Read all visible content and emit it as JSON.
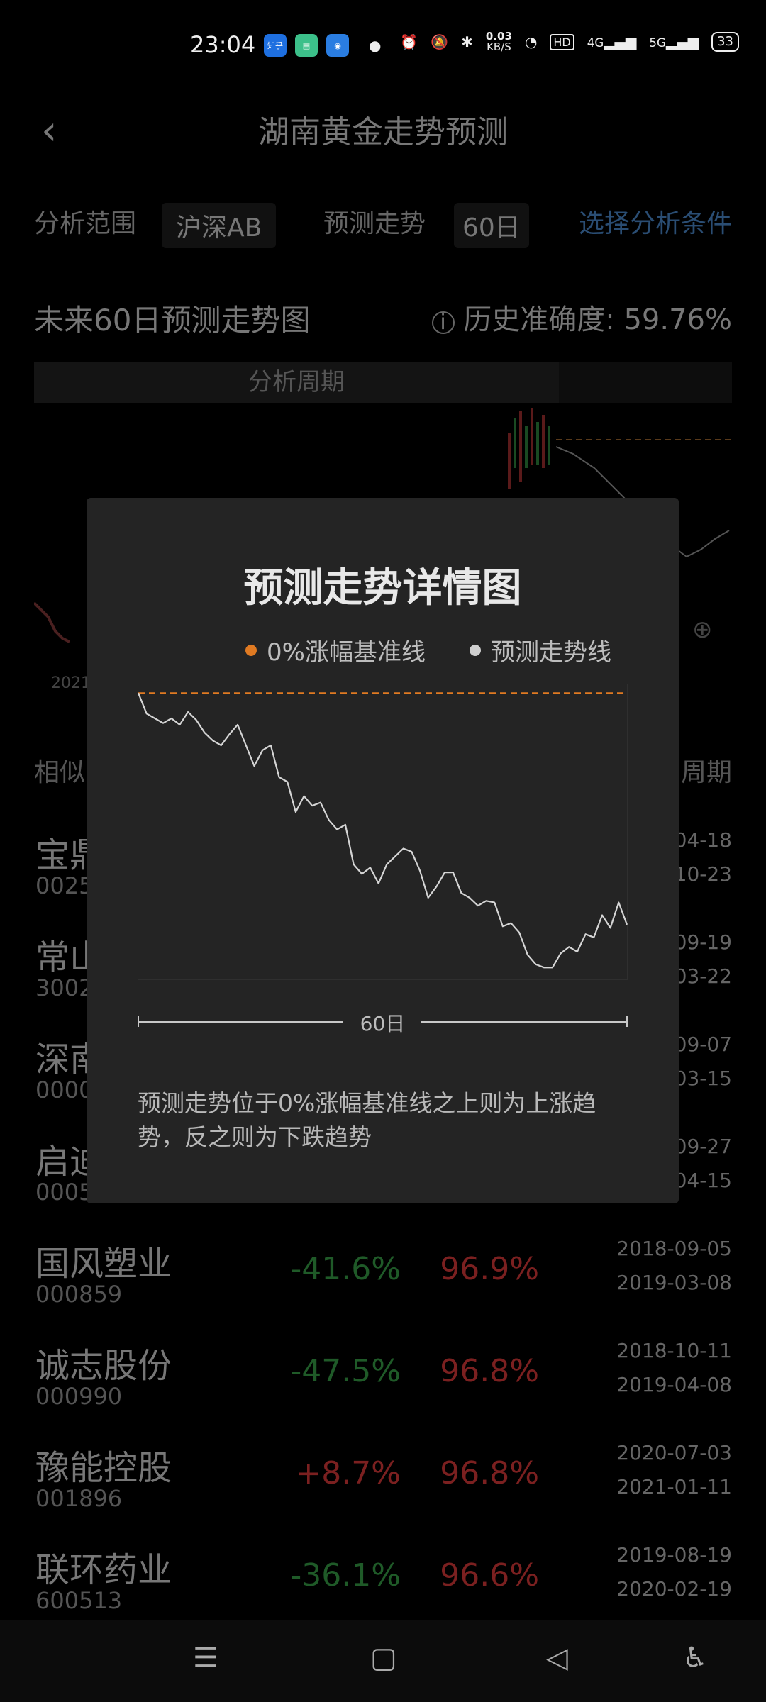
{
  "status_bar": {
    "time": "23:04",
    "app_icon_zhihu": "知乎",
    "net_speed_value": "0.03",
    "net_speed_unit": "KB/S",
    "hd_label": "HD",
    "net1": "4G",
    "net2": "5G",
    "battery": "33"
  },
  "header": {
    "title": "湖南黄金走势预测"
  },
  "filters": {
    "range_label": "分析范围",
    "range_value": "沪深AB",
    "trend_label": "预测走势",
    "trend_value": "60日",
    "choose_link": "选择分析条件"
  },
  "main_chart": {
    "title": "未来60日预测走势图",
    "accuracy_label": "历史准确度:",
    "accuracy_value": "59.76%",
    "period_label": "分析周期",
    "partial_year": "2021"
  },
  "list": {
    "header_left": "相似",
    "header_right": "周期",
    "rows": [
      {
        "name": "宝鼎",
        "code": "0025",
        "change": "",
        "prob": "",
        "date1": "04-18",
        "date2": "10-23"
      },
      {
        "name": "常山",
        "code": "3002",
        "change": "",
        "prob": "",
        "date1": "09-19",
        "date2": "03-22"
      },
      {
        "name": "深南",
        "code": "0000",
        "change": "",
        "prob": "",
        "date1": "09-07",
        "date2": "03-15"
      },
      {
        "name": "启迪",
        "code": "0005",
        "change": "",
        "prob": "",
        "date1": "09-27",
        "date2": "04-15"
      },
      {
        "name": "国风塑业",
        "code": "000859",
        "change": "-41.6%",
        "prob": "96.9%",
        "date1": "2018-09-05",
        "date2": "2019-03-08"
      },
      {
        "name": "诚志股份",
        "code": "000990",
        "change": "-47.5%",
        "prob": "96.8%",
        "date1": "2018-10-11",
        "date2": "2019-04-08"
      },
      {
        "name": "豫能控股",
        "code": "001896",
        "change": "+8.7%",
        "prob": "96.8%",
        "date1": "2020-07-03",
        "date2": "2021-01-11"
      },
      {
        "name": "联环药业",
        "code": "600513",
        "change": "-36.1%",
        "prob": "96.6%",
        "date1": "2019-08-19",
        "date2": "2020-02-19"
      }
    ]
  },
  "modal": {
    "title": "预测走势详情图",
    "legend_baseline": "0%涨幅基准线",
    "legend_forecast": "预测走势线",
    "period_label": "60日",
    "description": "预测走势位于0%涨幅基准线之上则为上涨趋势，反之则为下跌趋势",
    "colors": {
      "baseline": "#e07a22",
      "forecast": "#cfcfcf",
      "background": "#242424"
    }
  },
  "chart_data": {
    "type": "line",
    "title": "",
    "x": [
      1,
      2,
      3,
      4,
      5,
      6,
      7,
      8,
      9,
      10,
      11,
      12,
      13,
      14,
      15,
      16,
      17,
      18,
      19,
      20,
      21,
      22,
      23,
      24,
      25,
      26,
      27,
      28,
      29,
      30,
      31,
      32,
      33,
      34,
      35,
      36,
      37,
      38,
      39,
      40,
      41,
      42,
      43,
      44,
      45,
      46,
      47,
      48,
      49,
      50,
      51,
      52,
      53,
      54,
      55,
      56,
      57,
      58,
      59,
      60
    ],
    "series": [
      {
        "name": "预测走势线",
        "values": [
          0,
          -1.3,
          -1.6,
          -1.9,
          -1.6,
          -2.0,
          -1.2,
          -1.7,
          -2.5,
          -3.0,
          -3.3,
          -2.6,
          -2.0,
          -3.3,
          -4.6,
          -3.6,
          -3.3,
          -5.3,
          -5.6,
          -7.5,
          -6.5,
          -7.1,
          -6.9,
          -8.0,
          -8.6,
          -8.3,
          -10.8,
          -11.4,
          -11.0,
          -12.0,
          -10.8,
          -10.3,
          -9.8,
          -10.0,
          -11.2,
          -12.9,
          -12.2,
          -11.3,
          -11.3,
          -12.6,
          -12.9,
          -13.4,
          -13.1,
          -13.2,
          -14.7,
          -14.5,
          -15.1,
          -16.5,
          -17.1,
          -17.3,
          -17.3,
          -16.4,
          -16.0,
          -16.3,
          -15.2,
          -15.4,
          -14.0,
          -14.8,
          -13.2,
          -14.6
        ]
      },
      {
        "name": "0%涨幅基准线",
        "values": [
          0,
          0,
          0,
          0,
          0,
          0,
          0,
          0,
          0,
          0,
          0,
          0,
          0,
          0,
          0,
          0,
          0,
          0,
          0,
          0,
          0,
          0,
          0,
          0,
          0,
          0,
          0,
          0,
          0,
          0,
          0,
          0,
          0,
          0,
          0,
          0,
          0,
          0,
          0,
          0,
          0,
          0,
          0,
          0,
          0,
          0,
          0,
          0,
          0,
          0,
          0,
          0,
          0,
          0,
          0,
          0,
          0,
          0,
          0,
          0
        ]
      }
    ],
    "xlabel": "60日",
    "ylabel": "",
    "ylim": [
      -18,
      0.5
    ],
    "grid": false,
    "legend": "top-center"
  }
}
